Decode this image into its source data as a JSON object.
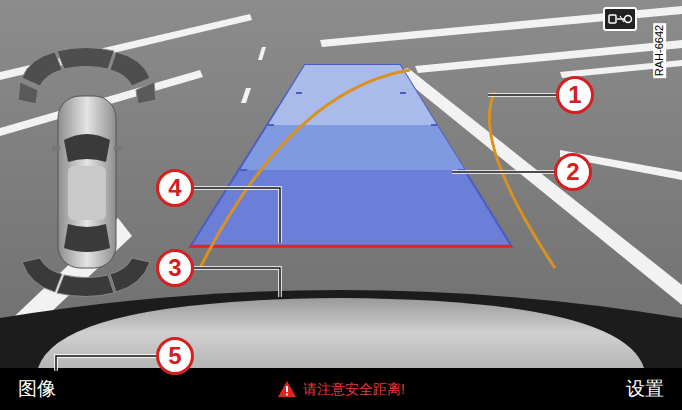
{
  "marker": "RAH-6642",
  "callouts": [
    {
      "label": "1"
    },
    {
      "label": "2"
    },
    {
      "label": "3"
    },
    {
      "label": "4"
    },
    {
      "label": "5"
    }
  ],
  "bottom_bar": {
    "left": "图像",
    "warning": "请注意安全距离!",
    "right": "设置"
  }
}
